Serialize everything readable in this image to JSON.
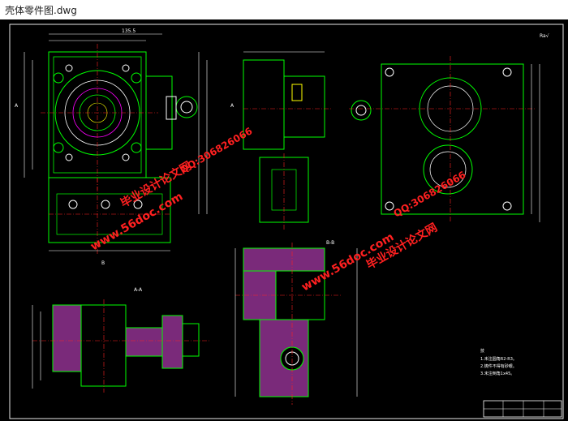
{
  "window": {
    "title": "壳体零件图.dwg"
  },
  "drawing": {
    "view_labels": {
      "section_aa": "A-A",
      "section_bb": "B-B",
      "roughness": "Ra√"
    },
    "dims": {
      "top_width": "135.5",
      "left_letter_a": "A",
      "right_letter_a": "A",
      "bottom_b": "B"
    },
    "notes": {
      "line1": "技",
      "line2": "1.未注圆角R2-R3。",
      "line3": "2.铸件不得有砂眼。",
      "line4": "3.未注倒角1x45。"
    },
    "watermarks": {
      "site": "www.56doc.com",
      "qq": "QQ:306826066",
      "cn": "毕业设计论文网"
    }
  }
}
